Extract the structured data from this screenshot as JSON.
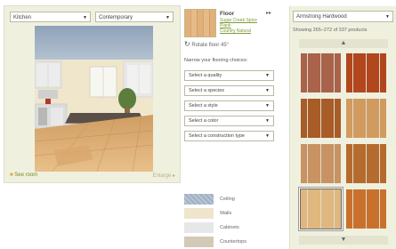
{
  "room": {
    "room_type": "Kitchen",
    "style": "Contemporary",
    "see_room": "See room",
    "enlarge": "Enlarge ▸"
  },
  "product": {
    "category": "Floor",
    "name_line1": "Sugar Creek Spice",
    "name_line2": "Plank",
    "name_line3": "Country Natural",
    "rotate": "Rotate floor 45°"
  },
  "filters": {
    "heading": "Narrow your flooring choices:",
    "items": [
      "Select a quality",
      "Select a species",
      "Select a style",
      "Select a color",
      "Select a construction type"
    ]
  },
  "legend": [
    {
      "label": "Ceiling",
      "color": "#9fb0c4"
    },
    {
      "label": "Walls",
      "color": "#efe5cc"
    },
    {
      "label": "Cabinets",
      "color": "#e7e7e7"
    },
    {
      "label": "Countertops",
      "color": "#d2c9b7"
    }
  ],
  "brand": {
    "selected": "Armstrong Hardwood",
    "showing": "Showing 265–272 of 337 products"
  },
  "tiles": [
    {
      "color": "#a8634a",
      "selected": false
    },
    {
      "color": "#b2461d",
      "selected": false
    },
    {
      "color": "#a85c27",
      "selected": false
    },
    {
      "color": "#d19a5f",
      "selected": false
    },
    {
      "color": "#c89263",
      "selected": false
    },
    {
      "color": "#b66b2e",
      "selected": false
    },
    {
      "color": "#e0b77e",
      "selected": true
    },
    {
      "color": "#c9712c",
      "selected": false
    }
  ],
  "icons": {
    "scroll_up": "▲",
    "scroll_down": "▼",
    "rotate": "↻",
    "nav": "▸▸"
  }
}
